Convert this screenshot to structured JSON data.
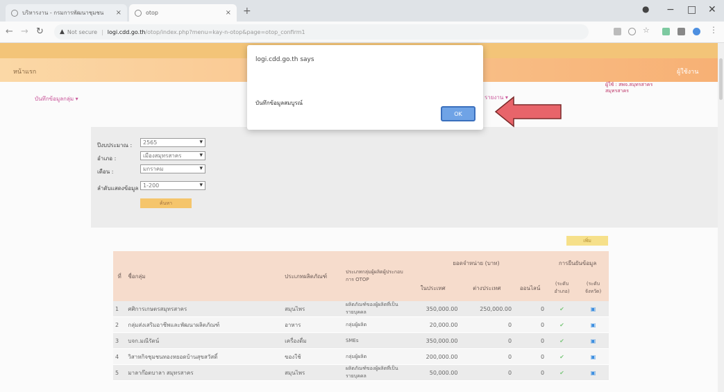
{
  "browser": {
    "tabs": [
      {
        "title": "บริหารงาน - กรมการพัฒนาชุมชน"
      },
      {
        "title": "otop"
      }
    ],
    "new_tab": "+",
    "window_controls": {
      "minimize": "−",
      "maximize": "□",
      "close": "✕"
    },
    "not_secure": "Not secure",
    "url_domain": "logi.cdd.go.th",
    "url_path": "/otop/index.php?menu=kay-n-otop&page=otop_confirm1"
  },
  "header": {
    "home_label": "หน้าแรก",
    "user_label": "ผู้ใช้งาน",
    "user_info": "ผู้ใช้ : สพจ.สมุทรสาคร\nสมุทรสาคร",
    "menu_left": "บันทึกข้อมูลกลุ่ม ▾",
    "menu_right": "รายงาน ▾"
  },
  "filter": {
    "labels": {
      "year": "ปีงบประมาณ :",
      "district": "อำเภอ :",
      "month": "เดือน :",
      "rows": "ลำดับแสดงข้อมูล"
    },
    "values": {
      "year": "2565",
      "district": "เมืองสมุทรสาคร",
      "month": "มกราคม",
      "rows": "1-200"
    },
    "search_button": "ค้นหา"
  },
  "add_button": "เพิ่ม",
  "table": {
    "headers": {
      "no": "ที่",
      "name": "ชื่อกลุ่ม",
      "type": "ประเภทผลิตภัณฑ์",
      "category": "ประเภทกลุ่มผู้ผลิตผู้ประกอบการ OTOP",
      "sales_group": "ยอดจำหน่าย (บาท)",
      "domestic": "ในประเทศ",
      "foreign": "ต่างประเทศ",
      "online": "ออนไลน์",
      "confirm_group": "การยืนยันข้อมูล",
      "confirm_district": "(ระดับอำเภอ)",
      "confirm_province": "(ระดับจังหวัด)"
    },
    "rows": [
      {
        "no": "1",
        "name": "ศศิการเกษตรสมุทรสาคร",
        "type": "สมุนไพร",
        "category": "ผลิตภัณฑ์ของผู้ผลิตที่เป็นรายบุคคล",
        "domestic": "350,000.00",
        "foreign": "250,000.00",
        "online": "0"
      },
      {
        "no": "2",
        "name": "กลุ่มส่งเสริมอาชีพและพัฒนาผลิตภัณฑ์",
        "type": "อาหาร",
        "category": "กลุ่มผู้ผลิต",
        "domestic": "20,000.00",
        "foreign": "0",
        "online": "0"
      },
      {
        "no": "3",
        "name": "บจก.มณีรัตน์",
        "type": "เครื่องดื่ม",
        "category": "SMEs",
        "domestic": "350,000.00",
        "foreign": "0",
        "online": "0"
      },
      {
        "no": "4",
        "name": "วิสาหกิจชุมชนทองหยอดบ้านสุขสวัสดิ์",
        "type": "ของใช้",
        "category": "กลุ่มผู้ผลิต",
        "domestic": "200,000.00",
        "foreign": "0",
        "online": "0"
      },
      {
        "no": "5",
        "name": "มาลาก๊อตบาลา สมุทรสาคร",
        "type": "สมุนไพร",
        "category": "ผลิตภัณฑ์ของผู้ผลิตที่เป็นรายบุคคล",
        "domestic": "50,000.00",
        "foreign": "0",
        "online": "0"
      }
    ]
  },
  "dialog": {
    "title": "logi.cdd.go.th says",
    "message": "บันทึกข้อมูลสมบูรณ์",
    "ok": "OK"
  },
  "colors": {
    "accent_orange": "#f3c478",
    "arrow_red": "#e8646a",
    "ok_blue": "#6fa3e6"
  }
}
